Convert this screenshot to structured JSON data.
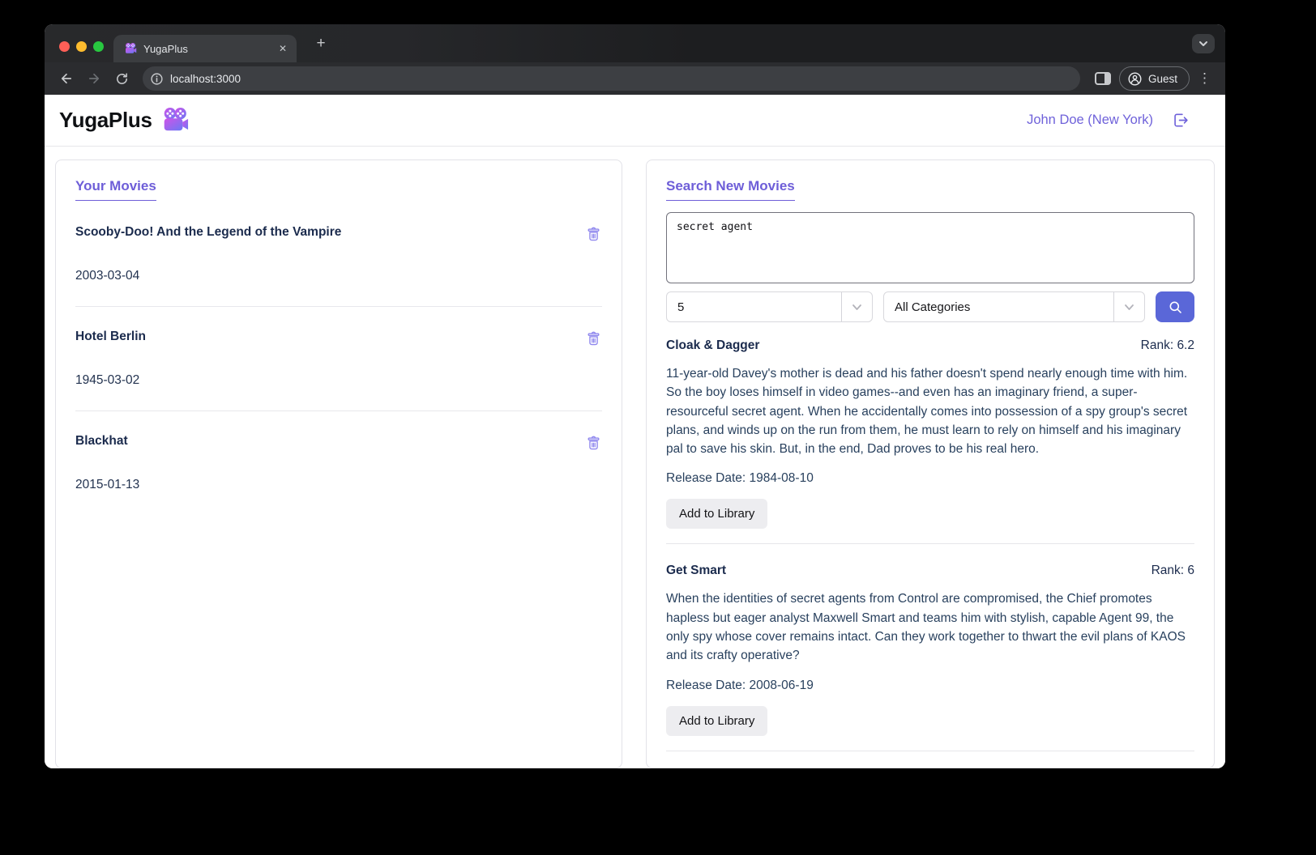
{
  "browser": {
    "tab_title": "YugaPlus",
    "tab_close": "✕",
    "new_tab": "+",
    "url": "localhost:3000",
    "guest_label": "Guest",
    "menu_dots": "⋮",
    "back": "←",
    "forward": "→"
  },
  "header": {
    "brand": "YugaPlus",
    "user_link": "John Doe (New York)"
  },
  "library": {
    "heading": "Your Movies",
    "movies": [
      {
        "title": "Scooby-Doo! And the Legend of the Vampire",
        "date": "2003-03-04"
      },
      {
        "title": "Hotel Berlin",
        "date": "1945-03-02"
      },
      {
        "title": "Blackhat",
        "date": "2015-01-13"
      }
    ]
  },
  "search": {
    "heading": "Search New Movies",
    "query": "secret agent",
    "limit_value": "5",
    "category_value": "All Categories",
    "results": [
      {
        "title": "Cloak & Dagger",
        "rank": "Rank: 6.2",
        "description": "11-year-old Davey's mother is dead and his father doesn't spend nearly enough time with him. So the boy loses himself in video games--and even has an imaginary friend, a super-resourceful secret agent. When he accidentally comes into possession of a spy group's secret plans, and winds up on the run from them, he must learn to rely on himself and his imaginary pal to save his skin. But, in the end, Dad proves to be his real hero.",
        "release": "Release Date: 1984-08-10",
        "add_label": "Add to Library"
      },
      {
        "title": "Get Smart",
        "rank": "Rank: 6",
        "description": "When the identities of secret agents from Control are compromised, the Chief promotes hapless but eager analyst Maxwell Smart and teams him with stylish, capable Agent 99, the only spy whose cover remains intact. Can they work together to thwart the evil plans of KAOS and its crafty operative?",
        "release": "Release Date: 2008-06-19",
        "add_label": "Add to Library"
      }
    ]
  },
  "colors": {
    "accent": "#6e5ed8",
    "search_button": "#5a67d8",
    "trash_icon": "#8f87ee",
    "traffic_red": "#ff5f57",
    "traffic_yellow": "#febc2e",
    "traffic_green": "#28c840"
  }
}
